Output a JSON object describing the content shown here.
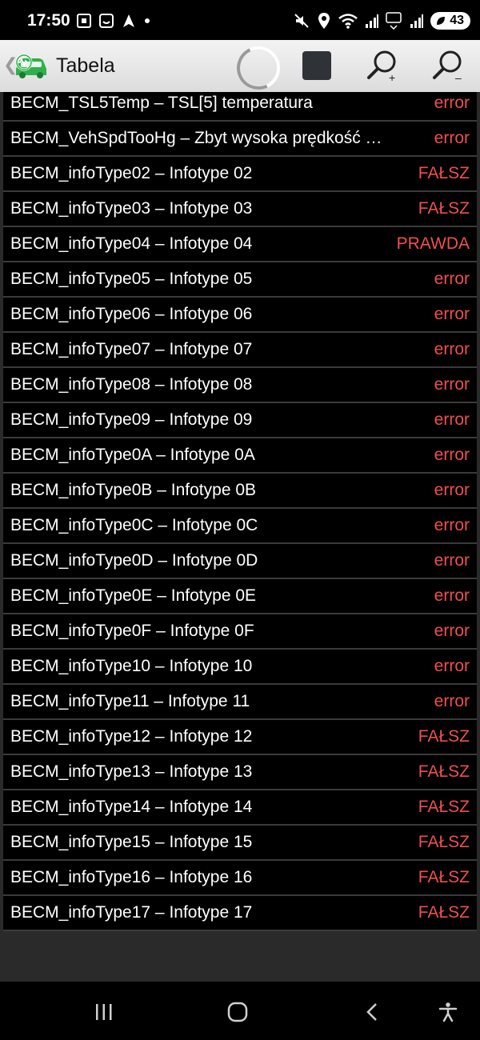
{
  "status_bar": {
    "time": "17:50",
    "battery": "43",
    "left_icons": [
      "screenshot-icon",
      "face-icon",
      "navigation-icon",
      "dot-icon"
    ],
    "right_icons": [
      "mute-icon",
      "location-icon",
      "wifi-icon",
      "signal-icon",
      "5g-icon",
      "signal-icon-2",
      "battery-icon"
    ]
  },
  "app_bar": {
    "title": "Tabela",
    "back_glyph": "❮"
  },
  "rows": [
    {
      "label": "BECM_TSL5Temp – TSL[5] temperatura",
      "value": "error"
    },
    {
      "label": "BECM_VehSpdTooHg – Zbyt wysoka prędkość …",
      "value": "error"
    },
    {
      "label": "BECM_infoType02 – Infotype 02",
      "value": "FAŁSZ"
    },
    {
      "label": "BECM_infoType03 – Infotype 03",
      "value": "FAŁSZ"
    },
    {
      "label": "BECM_infoType04 – Infotype 04",
      "value": "PRAWDA"
    },
    {
      "label": "BECM_infoType05 – Infotype 05",
      "value": "error"
    },
    {
      "label": "BECM_infoType06 – Infotype 06",
      "value": "error"
    },
    {
      "label": "BECM_infoType07 – Infotype 07",
      "value": "error"
    },
    {
      "label": "BECM_infoType08 – Infotype 08",
      "value": "error"
    },
    {
      "label": "BECM_infoType09 – Infotype 09",
      "value": "error"
    },
    {
      "label": "BECM_infoType0A – Infotype 0A",
      "value": "error"
    },
    {
      "label": "BECM_infoType0B – Infotype 0B",
      "value": "error"
    },
    {
      "label": "BECM_infoType0C – Infotype 0C",
      "value": "error"
    },
    {
      "label": "BECM_infoType0D – Infotype 0D",
      "value": "error"
    },
    {
      "label": "BECM_infoType0E – Infotype 0E",
      "value": "error"
    },
    {
      "label": "BECM_infoType0F – Infotype 0F",
      "value": "error"
    },
    {
      "label": "BECM_infoType10 – Infotype 10",
      "value": "error"
    },
    {
      "label": "BECM_infoType11 – Infotype 11",
      "value": "error"
    },
    {
      "label": "BECM_infoType12 – Infotype 12",
      "value": "FAŁSZ"
    },
    {
      "label": "BECM_infoType13 – Infotype 13",
      "value": "FAŁSZ"
    },
    {
      "label": "BECM_infoType14 – Infotype 14",
      "value": "FAŁSZ"
    },
    {
      "label": "BECM_infoType15 – Infotype 15",
      "value": "FAŁSZ"
    },
    {
      "label": "BECM_infoType16 – Infotype 16",
      "value": "FAŁSZ"
    },
    {
      "label": "BECM_infoType17 – Infotype 17",
      "value": "FAŁSZ"
    }
  ],
  "colors": {
    "value_text": "#ef4f4f",
    "logo_green": "#2db24a",
    "app_bar": "#e6e6e6"
  }
}
